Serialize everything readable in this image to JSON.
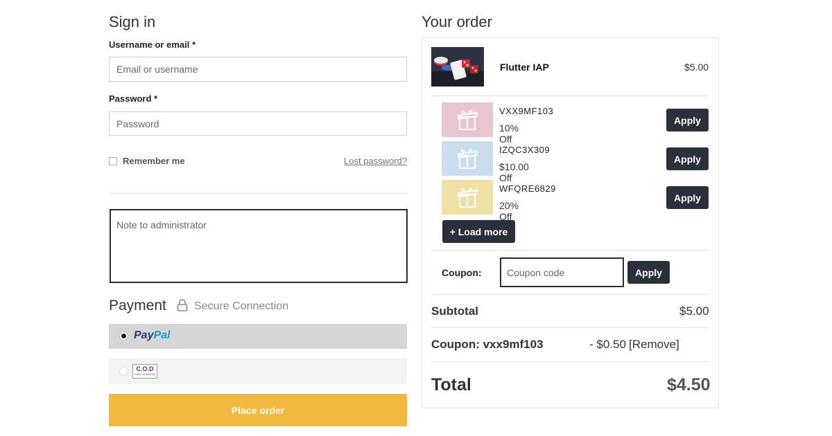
{
  "signin": {
    "title": "Sign in",
    "username_label": "Username or email *",
    "username_placeholder": "Email or username",
    "password_label": "Password *",
    "password_placeholder": "Password",
    "remember_label": "Remember me",
    "lost_password": "Lost password?",
    "note_placeholder": "Note to administrator"
  },
  "payment": {
    "title": "Payment",
    "secure_label": "Secure Connection",
    "paypal_text_1": "Pay",
    "paypal_text_2": "Pal",
    "cod_main": "C.O.D",
    "cod_sub": "Cash on delivery",
    "place_order": "Place order"
  },
  "order": {
    "title": "Your order",
    "product_name": "Flutter IAP",
    "product_price": "$5.00",
    "coupons": [
      {
        "code": "VXX9MF103",
        "discount": "10% Off",
        "color": "#e8c6d1",
        "apply": "Apply"
      },
      {
        "code": "IZQC3X309",
        "discount": "$10.00 Off",
        "color": "#c9ddef",
        "apply": "Apply"
      },
      {
        "code": "WFQRE6829",
        "discount": "20% Off",
        "color": "#efe0a8",
        "apply": "Apply"
      }
    ],
    "load_more": "+ Load more",
    "coupon_label": "Coupon:",
    "coupon_placeholder": "Coupon code",
    "coupon_apply": "Apply",
    "subtotal_label": "Subtotal",
    "subtotal_value": "$5.00",
    "applied_coupon_label": "Coupon: vxx9mf103",
    "applied_coupon_value": "- $0.50",
    "remove_label": "[Remove]",
    "total_label": "Total",
    "total_value": "$4.50"
  },
  "colors": {
    "accent": "#f2b83f",
    "dark_button": "#2b313c",
    "paypal_dark": "#253b80",
    "paypal_light": "#179bd7"
  }
}
